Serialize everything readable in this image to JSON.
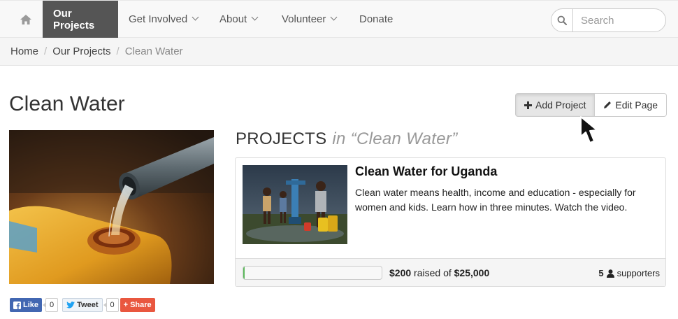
{
  "navbar": {
    "items": [
      {
        "label": "Our Projects",
        "active": true,
        "dropdown": false
      },
      {
        "label": "Get Involved",
        "active": false,
        "dropdown": true
      },
      {
        "label": "About",
        "active": false,
        "dropdown": true
      },
      {
        "label": "Volunteer",
        "active": false,
        "dropdown": true
      },
      {
        "label": "Donate",
        "active": false,
        "dropdown": false
      }
    ],
    "search_placeholder": "Search",
    "home_icon": "home-icon",
    "search_icon": "search-icon"
  },
  "breadcrumb": {
    "items": [
      "Home",
      "Our Projects",
      "Clean Water"
    ],
    "separator": "/"
  },
  "page": {
    "title": "Clean Water",
    "add_project_label": "Add Project",
    "edit_page_label": "Edit Page"
  },
  "social": {
    "like_label": "Like",
    "like_count": "0",
    "tweet_label": "Tweet",
    "tweet_count": "0",
    "share_label": "Share"
  },
  "projects": {
    "heading": "PROJECTS",
    "in_label": "in “Clean Water”",
    "items": [
      {
        "title": "Clean Water for Uganda",
        "description": "Clean water means health, income and education - especially for women and kids. Learn how in three minutes. Watch the video.",
        "raised_amount": "$200",
        "raised_text": " raised of ",
        "goal_amount": "$25,000",
        "progress_fraction": 0.008,
        "supporters_count": "5",
        "supporters_label": "supporters"
      }
    ]
  },
  "colors": {
    "nav_active_bg": "#555555",
    "facebook": "#4267b2",
    "share": "#e9573f"
  }
}
